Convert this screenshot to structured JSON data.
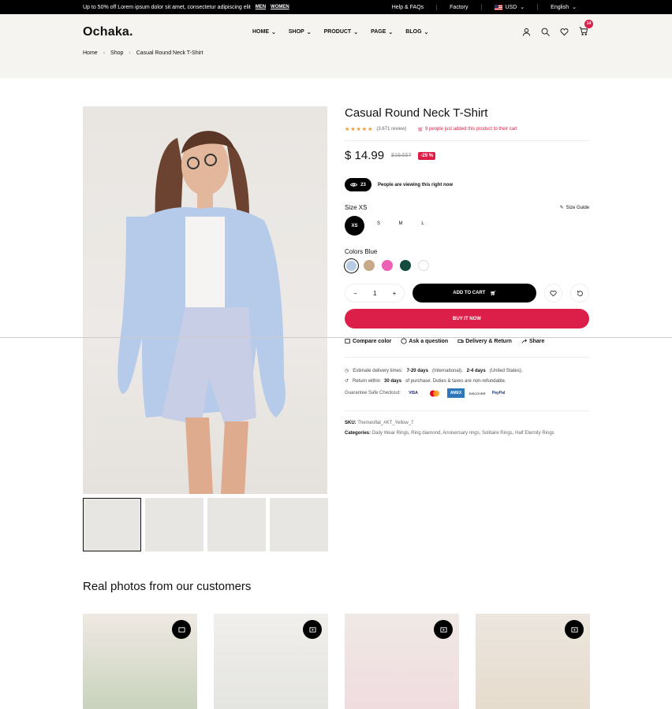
{
  "topbar": {
    "promo": "Up to 50% off Lorem ipsum dolor sit amet, consectetur adipiscing elit",
    "men": "MEN",
    "women": "WOMEN",
    "help": "Help & FAQs",
    "factory": "Factory",
    "currency": "USD",
    "language": "English"
  },
  "header": {
    "logo": "Ochaka.",
    "menu": [
      "HOME",
      "SHOP",
      "PRODUCT",
      "PAGE",
      "BLOG"
    ],
    "cart_count": "14"
  },
  "breadcrumb": [
    "Home",
    "Shop",
    "Casual Round Neck T-Shirt"
  ],
  "product": {
    "title": "Casual Round Neck T-Shirt",
    "stars": "★★★★★",
    "reviews": "(3.671 review)",
    "added": "9 people just added this product to their cart",
    "price": "$ 14.99",
    "old_price": "$19.55?",
    "discount": "-29 %",
    "viewers": "23",
    "viewing_text": "People are viewing this right now",
    "size_label": "Size XS",
    "size_guide": "Size Guide",
    "sizes": [
      "XS",
      "S",
      "M",
      "L"
    ],
    "color_label": "Colors Blue",
    "colors": [
      "#b7cbe4",
      "#c7aa87",
      "#ee5fb6",
      "#144d3e",
      "#ffffff"
    ],
    "qty": "1",
    "add_to_cart": "ADD TO CART",
    "buy_now": "BUY IT NOW",
    "actions": [
      "Compare color",
      "Ask a question",
      "Delivery & Return",
      "Share"
    ],
    "delivery": {
      "prefix": "Estimate delivery times:",
      "d1": "7-20 days",
      "mid": "(International),",
      "d2": "2-4 days",
      "suffix": "(United States).",
      "return_prefix": "Return within",
      "return_days": "30 days",
      "return_suffix": "of purchase. Duties & taxes are non-refundable."
    },
    "checkout_label": "Guarantee Safe Checkout:",
    "cards": [
      "VISA",
      "MasterCard",
      "AMEX",
      "DISCOVER",
      "PayPal"
    ],
    "sku_label": "SKU:",
    "sku": "Themesflat_#KT_Yellow_7",
    "categories_label": "Categories:",
    "categories": "Daily Wear Rings, Ring diamond, Anniversary rings, Solitaire Rings, Half Eternity Rings"
  },
  "customers": {
    "title": "Real photos from our customers"
  }
}
